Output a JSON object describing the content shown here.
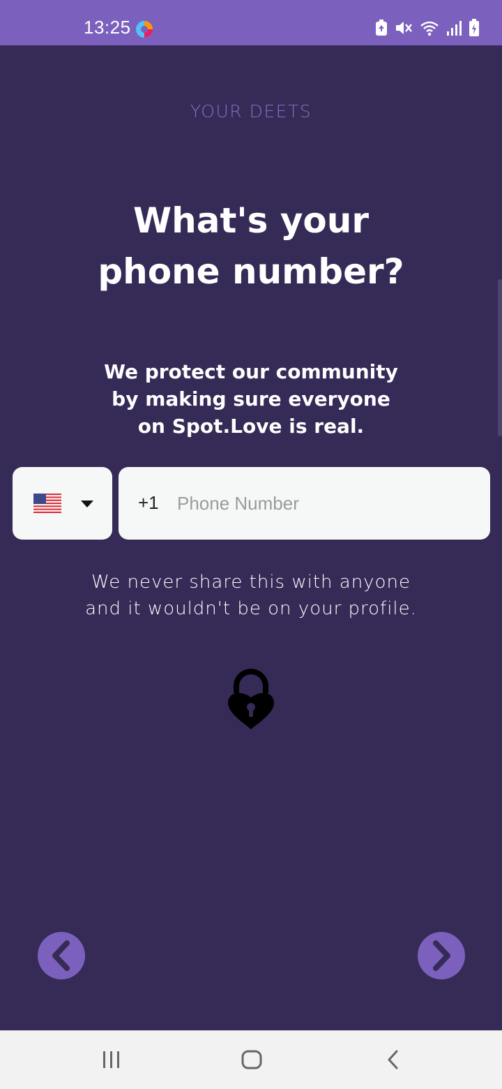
{
  "status_bar": {
    "time": "13:25",
    "icons": [
      "browser-app-icon",
      "save-battery-icon",
      "mute-icon",
      "wifi-icon",
      "signal-icon",
      "battery-charging-icon"
    ]
  },
  "screen": {
    "section_tag": "YOUR DEETS",
    "title_lines": [
      "What's your",
      "phone number?"
    ],
    "subtitle_lines": [
      "We protect our community",
      "by making sure everyone",
      "on Spot.Love is real."
    ],
    "country_picker": {
      "flag": "us-flag-icon",
      "arrow": "dropdown-arrow-icon"
    },
    "phone_field": {
      "prefix": "+1",
      "value": "",
      "placeholder": "Phone Number"
    },
    "privacy_lines": [
      "We never share this with anyone",
      "and it wouldn't be on your profile."
    ],
    "lock_icon": "heart-lock-icon"
  },
  "navigation": {
    "back_icon": "chevron-left-icon",
    "next_icon": "chevron-right-icon"
  },
  "system_nav": {
    "recents": "recents-icon",
    "home": "home-icon",
    "back": "back-icon"
  },
  "colors": {
    "background": "#362a57",
    "status_bar": "#7b61bd",
    "accent": "#7b61bd",
    "section_tag": "#8270c4",
    "field_background": "#f6f8f8"
  }
}
